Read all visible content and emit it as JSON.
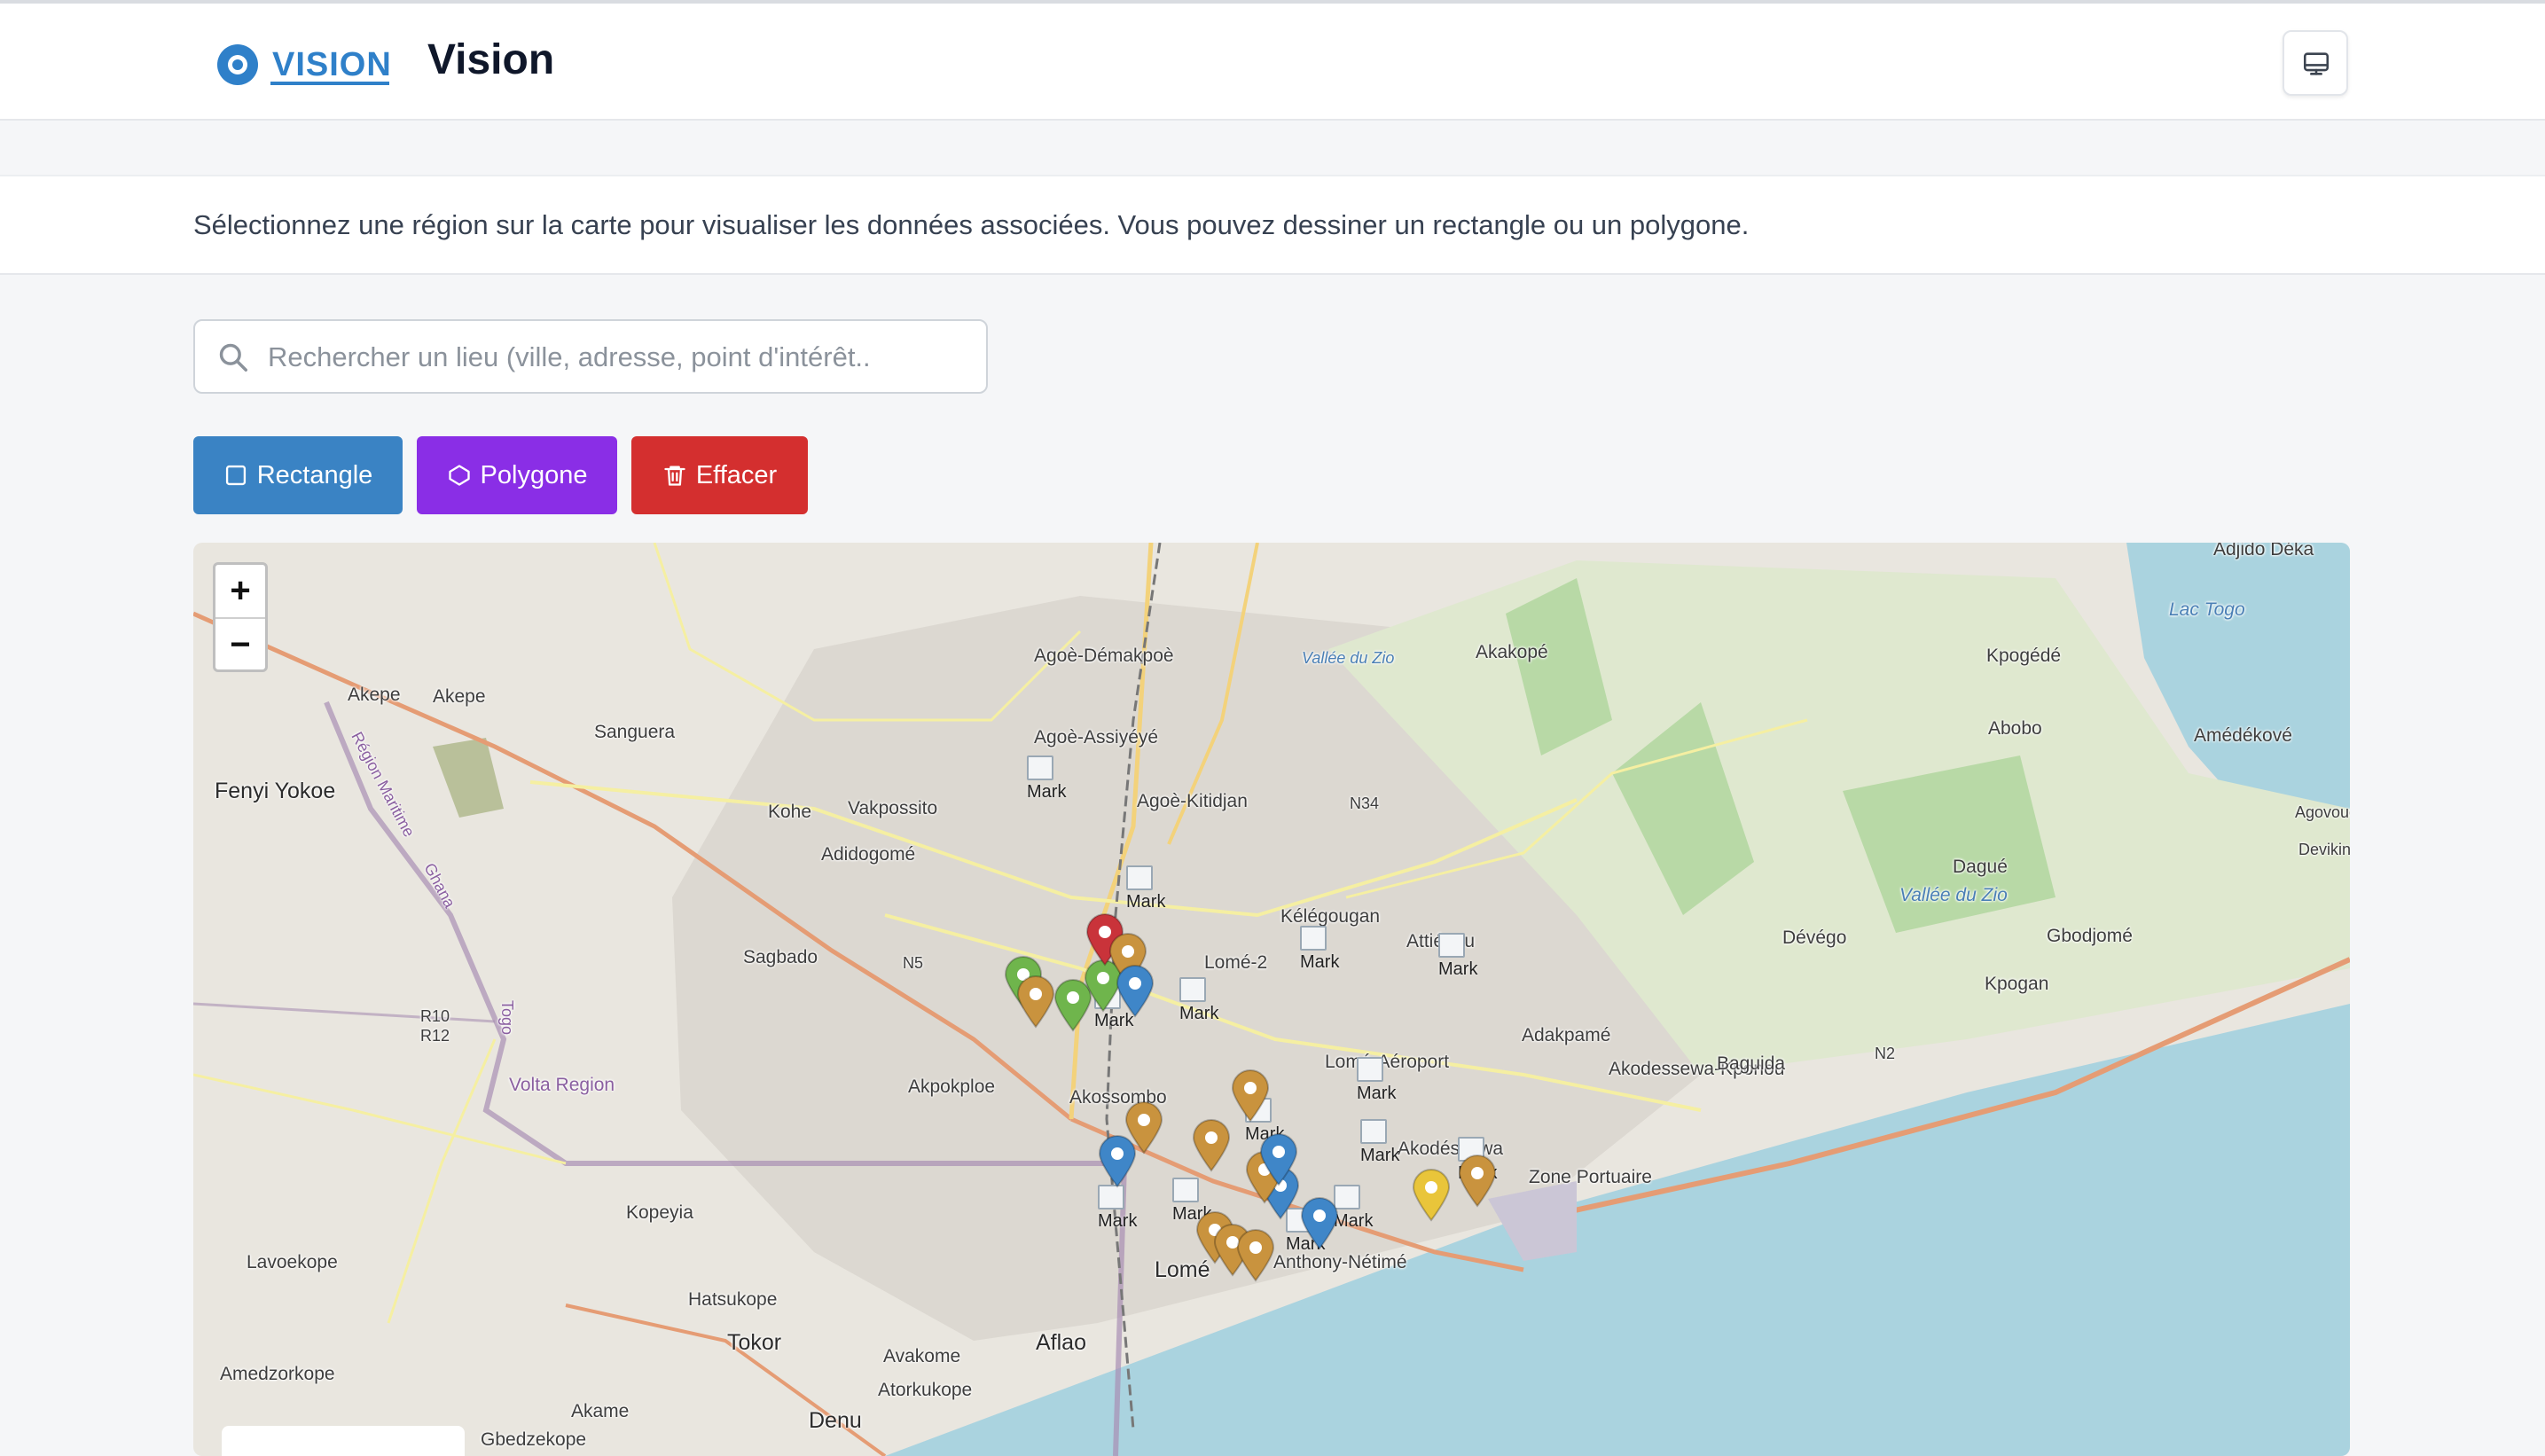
{
  "header": {
    "logo_text": "VISION",
    "title": "Vision",
    "screen_button_icon": "monitor-icon"
  },
  "instructions": "Sélectionnez une région sur la carte pour visualiser les données associées. Vous pouvez dessiner un rectangle ou un polygone.",
  "search": {
    "placeholder": "Rechercher un lieu (ville, adresse, point d'intérêt..",
    "value": ""
  },
  "tools": {
    "rectangle_label": "Rectangle",
    "polygon_label": "Polygone",
    "clear_label": "Effacer"
  },
  "colors": {
    "accent": "#2f80c9",
    "rectangle": "#3a83c4",
    "polygon": "#8a2ee6",
    "clear": "#d42f2f"
  },
  "map": {
    "zoom_in": "+",
    "zoom_out": "−",
    "places": [
      "Adjido Déka",
      "Lac Togo",
      "Agoè-Démakpoè",
      "Akakopé",
      "Vallée du Zio",
      "Kpogédé",
      "Akepe",
      "Akepe",
      "Sanguera",
      "Agoè-Assiyéyé",
      "Abobo",
      "Amédékové",
      "Fenyi Yokoe",
      "Kohe",
      "Vakpossito",
      "Agoè-Kitidjan",
      "N34",
      "Agovoudo",
      "Adidogomé",
      "Devikinm",
      "Dagué",
      "Vallée du Zio",
      "Kélégougan",
      "Attiégou",
      "Dévégo",
      "Gbodjomé",
      "Sagbado",
      "N5",
      "Lomé-2",
      "Kpogan",
      "Akodessewa-Kponou",
      "Adakpamé",
      "Baguida",
      "N2",
      "R10",
      "R12",
      "Volta Region",
      "Akpokploe",
      "Akossombo",
      "Zone Portuaire",
      "Lomé",
      "Kopeyia",
      "Lavoekope",
      "Hatsukope",
      "Aflao",
      "Tokor",
      "Avakome",
      "Atorkukope",
      "Amedzorkope",
      "Akame",
      "Denu",
      "Gbedzekope",
      "Région Maritime",
      "Ghana",
      "Togo",
      "Lomé-Aéroport",
      "Akodésséwa",
      "Anthony-Nétimé"
    ],
    "markers": [
      {
        "color": "#6fb54c"
      },
      {
        "color": "#6fb54c"
      },
      {
        "color": "#6fb54c"
      },
      {
        "color": "#c9333a"
      },
      {
        "color": "#c9933e"
      },
      {
        "color": "#c9933e"
      },
      {
        "color": "#3f86c8"
      },
      {
        "color": "#3f86c8"
      },
      {
        "color": "#c9933e"
      },
      {
        "color": "#c9933e"
      },
      {
        "color": "#3f86c8"
      },
      {
        "color": "#c9933e"
      },
      {
        "color": "#c9933e"
      },
      {
        "color": "#3f86c8"
      },
      {
        "color": "#c9933e"
      },
      {
        "color": "#c9933e"
      },
      {
        "color": "#c9933e"
      },
      {
        "color": "#3f86c8"
      },
      {
        "color": "#e9c53a"
      },
      {
        "color": "#c9933e"
      }
    ],
    "image_marker_alt": "Mark"
  }
}
